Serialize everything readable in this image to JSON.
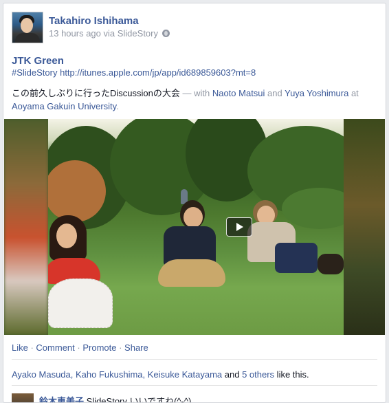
{
  "post": {
    "author": "Takahiro Ishihama",
    "meta": "13 hours ago via SlideStory",
    "privacy_icon": "globe-icon",
    "title": "JTK Green",
    "link": "#SlideStory http://itunes.apple.com/jp/app/id689859603?mt=8",
    "status_text": "この前久しぶりに行ったDiscussionの大会",
    "with_sep": " — with ",
    "tag1": "Naoto Matsui",
    "and_word": " and ",
    "tag2": "Yuya Yoshimura",
    "at_word": " at",
    "location": "Aoyama Gakuin University",
    "period": "."
  },
  "actions": {
    "like": "Like",
    "comment": "Comment",
    "promote": "Promote",
    "share": "Share",
    "sep": " · "
  },
  "likes": {
    "people": "Ayako Masuda, Kaho Fukushima, Keisuke Katayama",
    "and_word": " and ",
    "others": "5 others",
    "suffix": " like this."
  },
  "comment": {
    "name": "鈴木恵美子",
    "text": " SlideStory いいですね(^-^)"
  },
  "colors": {
    "link": "#3b5998",
    "muted": "#9197a3",
    "text": "#141823"
  }
}
